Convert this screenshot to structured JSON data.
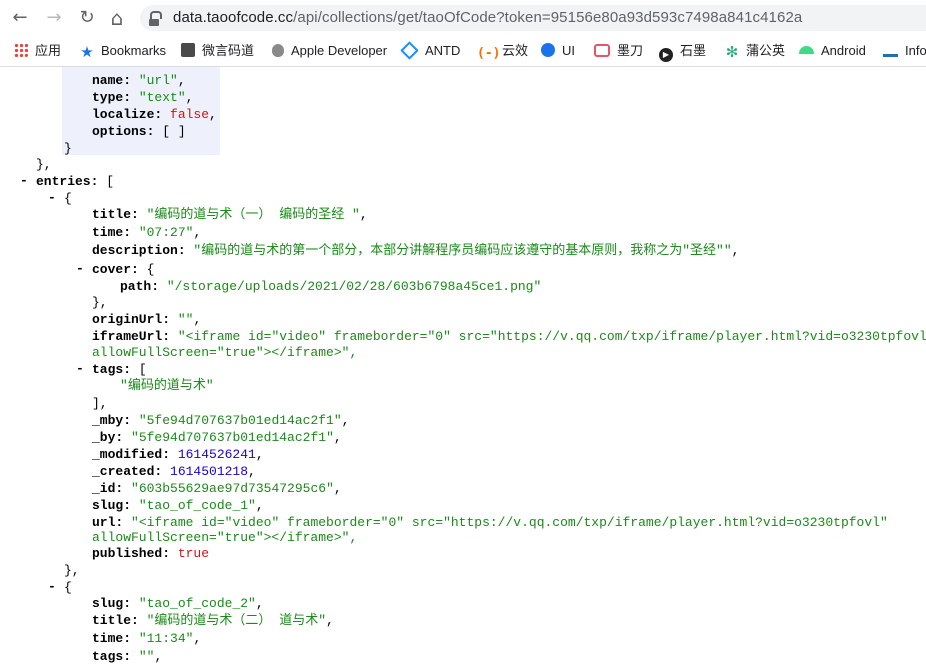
{
  "browser": {
    "url_host": "data.taoofcode.cc",
    "url_rest": "/api/collections/get/taoOfCode?token=95156e80a93d593c7498a841c4162a",
    "nav": {
      "back": "←",
      "forward": "→",
      "reload": "↻",
      "home": "⌂"
    }
  },
  "bookmarks": [
    {
      "label": "应用",
      "icon": "apps-grid-icon",
      "color": "#e8453c"
    },
    {
      "label": "Bookmarks",
      "icon": "star-icon",
      "color": "#1a73e8"
    },
    {
      "label": "微言码道",
      "icon": "site-favicon-icon",
      "color": "#555555"
    },
    {
      "label": "Apple Developer",
      "icon": "apple-icon",
      "color": "#888888"
    },
    {
      "label": "ANTD",
      "icon": "diamond-icon",
      "color": "#1890ff"
    },
    {
      "label": "云效",
      "icon": "bracket-icon",
      "color": "#ff6a00"
    },
    {
      "label": "UI",
      "icon": "mascot-icon",
      "color": "#1a73e8"
    },
    {
      "label": "墨刀",
      "icon": "modao-icon",
      "color": "#e9546b"
    },
    {
      "label": "石墨",
      "icon": "play-circle-icon",
      "color": "#222222"
    },
    {
      "label": "蒲公英",
      "icon": "dandelion-icon",
      "color": "#2aa876"
    },
    {
      "label": "Android",
      "icon": "android-icon",
      "color": "#3ddc84"
    },
    {
      "label": "Info",
      "icon": "infoq-icon",
      "color": "#1f6fb2"
    }
  ],
  "json": {
    "field_name": "url",
    "field_type": "text",
    "field_localize": "false",
    "entry1": {
      "title": "编码的道与术（一） 编码的圣经 ",
      "time": "07:27",
      "description": "编码的道与术的第一个部分，本部分讲解程序员编码应该遵守的基本原则，我称之为\"圣经\"",
      "cover_path": "/storage/uploads/2021/02/28/603b6798a45ce1.png",
      "originUrl": "",
      "iframeUrl_1": "<iframe id=\"video\" frameborder=\"0\" src=\"https://v.qq.com/txp/iframe/player.html?vid=o3230tpfovl",
      "iframeUrl_2": "allowFullScreen=\"true\"></iframe>\",",
      "tag": "编码的道与术",
      "_mby": "5fe94d707637b01ed14ac2f1",
      "_by": "5fe94d707637b01ed14ac2f1",
      "_modified": "1614526241",
      "_created": "1614501218",
      "_id": "603b55629ae97d73547295c6",
      "slug": "tao_of_code_1",
      "url_1": "<iframe id=\"video\" frameborder=\"0\" src=\"https://v.qq.com/txp/iframe/player.html?vid=o3230tpfovl\"",
      "url_2": "allowFullScreen=\"true\"></iframe>\",",
      "published": "true"
    },
    "entry2": {
      "slug": "tao_of_code_2",
      "title": "编码的道与术（二） 道与术",
      "time": "11:34",
      "tags": ""
    }
  }
}
